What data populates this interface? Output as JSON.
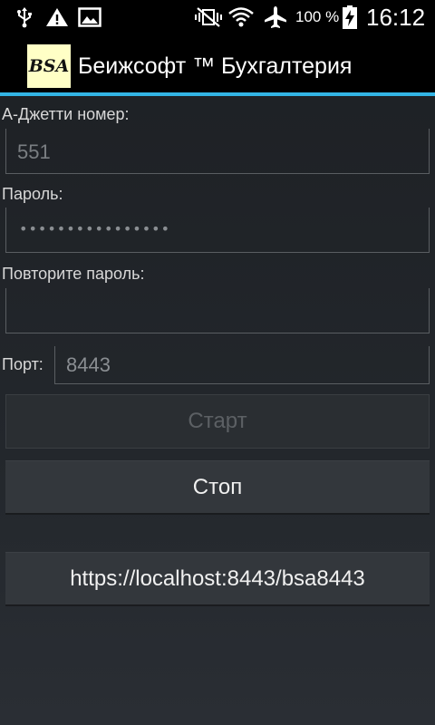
{
  "status_bar": {
    "icons": [
      "usb-icon",
      "warning-icon",
      "image-icon",
      "no-vibrate-icon",
      "wifi-icon",
      "airplane-icon",
      "battery-charging-icon"
    ],
    "battery": "100 %",
    "time": "16:12"
  },
  "app_bar": {
    "logo_text": "BSA",
    "title": "Беижсофт ™ Бухгалтерия",
    "accent_color": "#33b5e5"
  },
  "form": {
    "jetty_label": "A-Джетти номер:",
    "jetty_value": "551",
    "password_label": "Пароль:",
    "password_value": "••••••••••••••••",
    "repeat_label": "Повторите пароль:",
    "repeat_value": "",
    "port_label": "Порт:",
    "port_value": "8443"
  },
  "buttons": {
    "start": "Старт",
    "stop": "Стоп",
    "url": "https://localhost:8443/bsa8443"
  }
}
